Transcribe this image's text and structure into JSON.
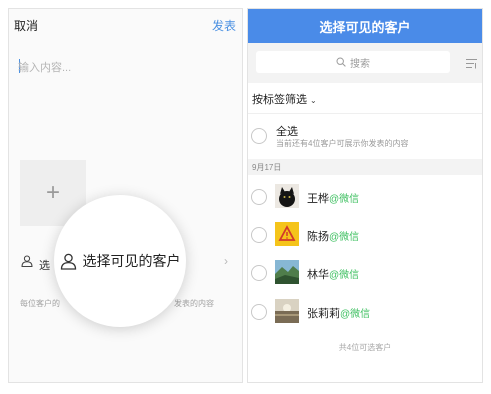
{
  "left": {
    "cancel": "取消",
    "publish": "发表",
    "input_placeholder": "输入内容...",
    "add_photo": "+",
    "row_label": "选",
    "arrow": "›",
    "hint": "每位客户的",
    "hint_tail": "发表的内容",
    "magnifier_label": "选择可见的客户"
  },
  "right": {
    "title": "选择可见的客户",
    "search_placeholder": "搜索",
    "tag_filter": "按标签筛选",
    "tag_filter_caret": "⌄",
    "select_all_title": "全选",
    "select_all_sub": "当前还有4位客户可展示你发表的内容",
    "date": "9月17日",
    "customers": [
      {
        "name": "王桦",
        "source": "@微信"
      },
      {
        "name": "陈扬",
        "source": "@微信"
      },
      {
        "name": "林华",
        "source": "@微信"
      },
      {
        "name": "张莉莉",
        "source": "@微信"
      }
    ],
    "footer": "共4位可选客户"
  },
  "colors": {
    "accent": "#4a8be8",
    "wechat_green": "#3cbf5f"
  }
}
